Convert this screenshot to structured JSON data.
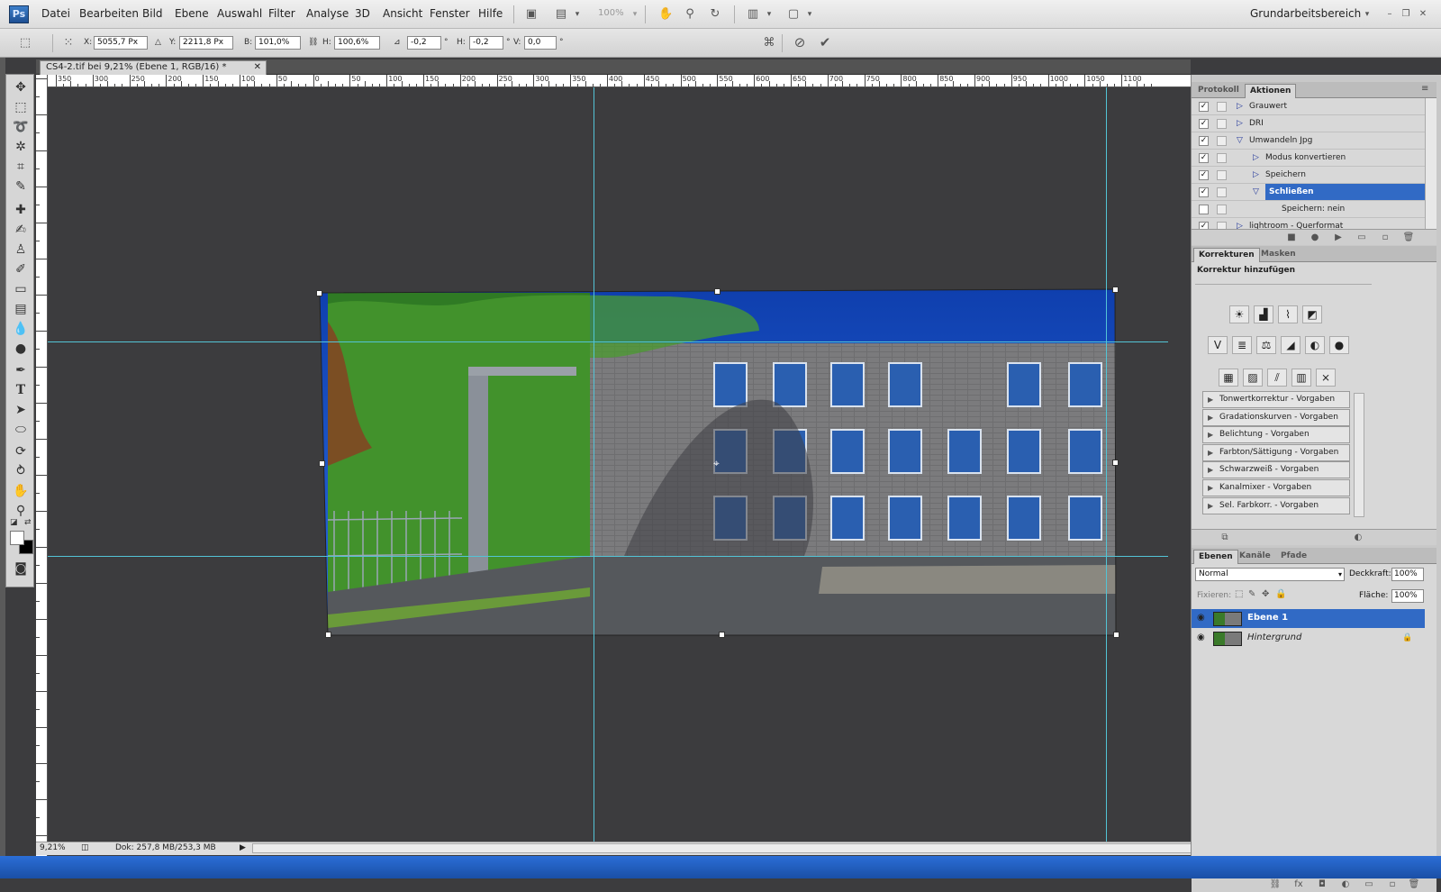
{
  "app": {
    "logo": "Ps",
    "workspace": "Grundarbeitsbereich"
  },
  "menu": [
    "Datei",
    "Bearbeiten",
    "Bild",
    "Ebene",
    "Auswahl",
    "Filter",
    "Analyse",
    "3D",
    "Ansicht",
    "Fenster",
    "Hilfe"
  ],
  "toolbar": {
    "zoom": "100%"
  },
  "options": {
    "x_label": "X:",
    "x": "5055,7 Px",
    "y_label": "Y:",
    "y": "2211,8 Px",
    "b_label": "B:",
    "b": "101,0%",
    "h_label": "H:",
    "h": "100,6%",
    "angle": "-0,2",
    "angle_unit": "°",
    "hs_label": "H:",
    "hs": "-0,2",
    "vs_label": "V:",
    "vs": "0,0"
  },
  "document": {
    "tab_title": "CS4-2.tif bei 9,21% (Ebene 1, RGB/16) *"
  },
  "ruler": {
    "h_labels": [
      "350",
      "300",
      "250",
      "200",
      "150",
      "100",
      "50",
      "0",
      "50",
      "100",
      "150",
      "200",
      "250",
      "300",
      "350",
      "400",
      "450",
      "500",
      "550",
      "600",
      "650",
      "700",
      "750",
      "800",
      "850",
      "900",
      "950",
      "1000",
      "1050",
      "1100"
    ]
  },
  "status": {
    "zoom": "9,21%",
    "doc": "Dok: 257,8 MB/253,3 MB"
  },
  "actions_panel": {
    "tabs": [
      "Protokoll",
      "Aktionen"
    ],
    "rows": [
      {
        "label": "Grauwert",
        "level": 0,
        "open": false,
        "check": "✓"
      },
      {
        "label": "DRI",
        "level": 0,
        "open": false,
        "check": "✓"
      },
      {
        "label": "Umwandeln Jpg",
        "level": 0,
        "open": true,
        "check": "✓"
      },
      {
        "label": "Modus konvertieren",
        "level": 1,
        "open": false,
        "check": "✓"
      },
      {
        "label": "Speichern",
        "level": 1,
        "open": false,
        "check": "✓"
      },
      {
        "label": "Schließen",
        "level": 1,
        "open": true,
        "check": "✓",
        "selected": true
      },
      {
        "label": "Speichern: nein",
        "level": 2,
        "open": null,
        "check": ""
      },
      {
        "label": "lightroom - Querformat",
        "level": 0,
        "open": false,
        "check": "✓"
      }
    ]
  },
  "adjustments_panel": {
    "tabs": [
      "Korrekturen",
      "Masken"
    ],
    "heading": "Korrektur hinzufügen",
    "icons_row1": [
      "☀",
      "▟",
      "⌇",
      "◩"
    ],
    "icons_row2": [
      "V",
      "≣",
      "⚖",
      "◢",
      "◐",
      "●"
    ],
    "icons_row3": [
      "▦",
      "▨",
      "⫽",
      "▥",
      "⨯"
    ],
    "presets": [
      "Tonwertkorrektur - Vorgaben",
      "Gradationskurven - Vorgaben",
      "Belichtung - Vorgaben",
      "Farbton/Sättigung - Vorgaben",
      "Schwarzweiß - Vorgaben",
      "Kanalmixer - Vorgaben",
      "Sel. Farbkorr. - Vorgaben"
    ]
  },
  "layers_panel": {
    "tabs": [
      "Ebenen",
      "Kanäle",
      "Pfade"
    ],
    "blend": "Normal",
    "opacity_label": "Deckkraft:",
    "opacity": "100%",
    "lock_label": "Fixieren:",
    "fill_label": "Fläche:",
    "fill": "100%",
    "layers": [
      {
        "name": "Ebene 1",
        "selected": true
      },
      {
        "name": "Hintergrund",
        "selected": false
      }
    ]
  },
  "colors": {
    "guide": "#53c4d6",
    "selection": "#316ac5",
    "canvas": "#3c3c3e"
  }
}
